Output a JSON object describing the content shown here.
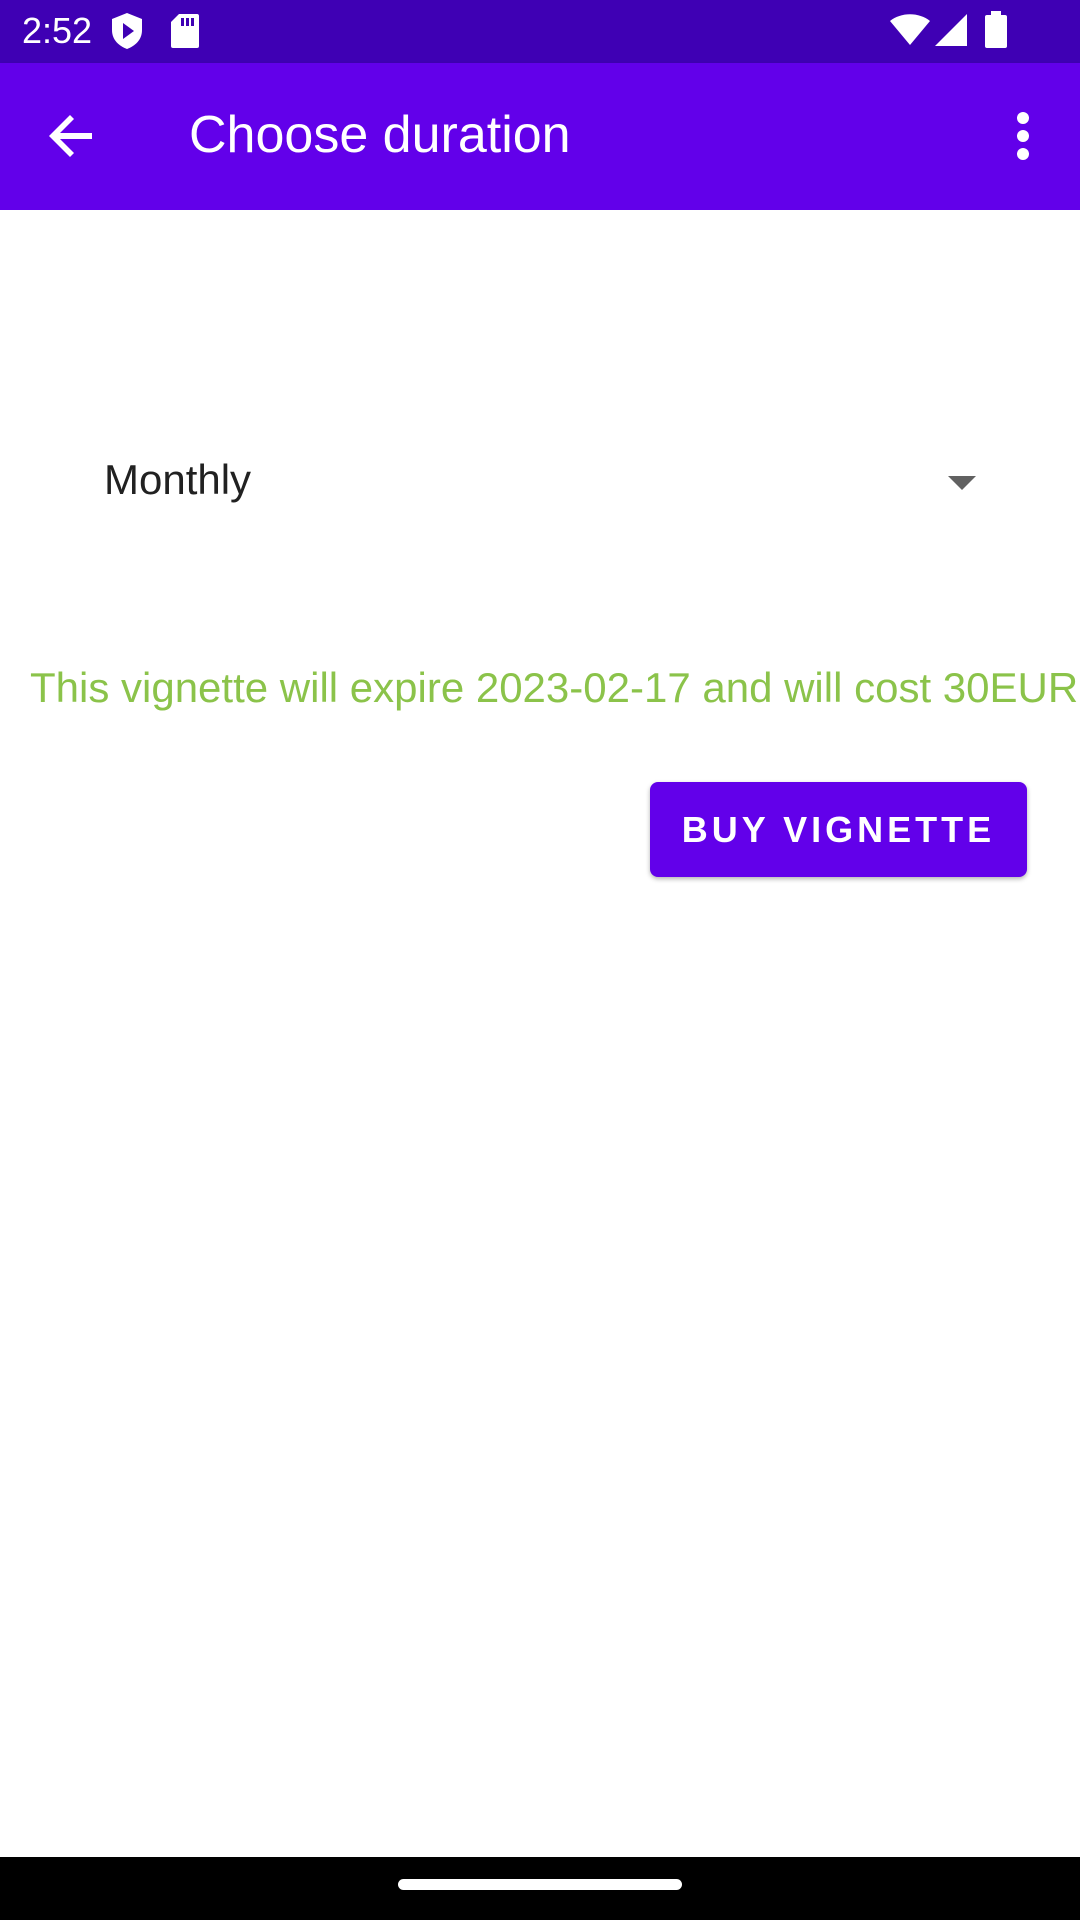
{
  "status_bar": {
    "time": "2:52",
    "icons": [
      "play-protect-icon",
      "sd-card-icon",
      "wifi-icon",
      "cell-signal-icon",
      "battery-icon"
    ]
  },
  "app_bar": {
    "title": "Choose duration",
    "back_icon": "arrow-back-icon",
    "overflow_icon": "more-vert-icon"
  },
  "duration_spinner": {
    "selected": "Monthly",
    "icon": "dropdown-arrow-icon"
  },
  "info": {
    "text": "This vignette will expire 2023-02-17 and will cost 30EUR."
  },
  "buy_button": {
    "label": "BUY VIGNETTE"
  },
  "colors": {
    "status_bar": "#3f00b4",
    "app_bar": "#6200ea",
    "accent": "#6200ea",
    "info_text": "#8bc34a"
  }
}
